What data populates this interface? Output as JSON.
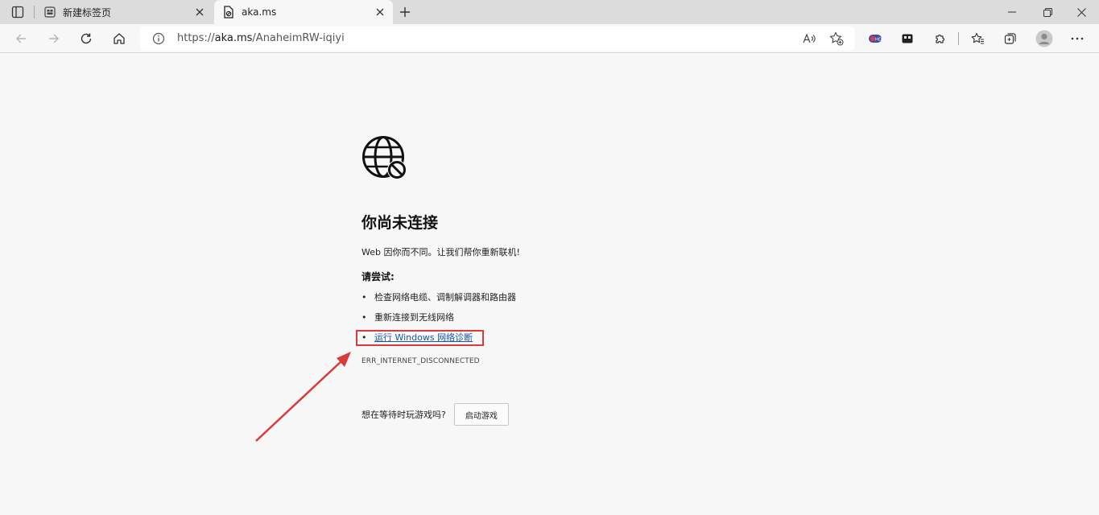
{
  "tabs": [
    {
      "title": "新建标签页",
      "active": false
    },
    {
      "title": "aka.ms",
      "active": true
    }
  ],
  "address_bar": {
    "prefix": "https://",
    "host": "aka.ms",
    "path": "/AnaheimRW-iqiyi"
  },
  "page": {
    "heading": "你尚未连接",
    "description": "Web 因你而不同。让我们帮你重新联机!",
    "try_heading": "请尝试:",
    "suggestions": [
      {
        "text": "检查网络电缆、调制解调器和路由器",
        "link": false
      },
      {
        "text": "重新连接到无线网络",
        "link": false
      },
      {
        "text": "运行 Windows 网络诊断",
        "link": true
      }
    ],
    "error_code": "ERR_INTERNET_DISCONNECTED",
    "game_prompt": "想在等待时玩游戏吗?",
    "game_button": "启动游戏"
  },
  "colors": {
    "annotation_red": "#d93a3a",
    "link_blue": "#1a56b0",
    "tabbar_bg": "#dcdcdc",
    "page_bg": "#f7f7f7"
  }
}
